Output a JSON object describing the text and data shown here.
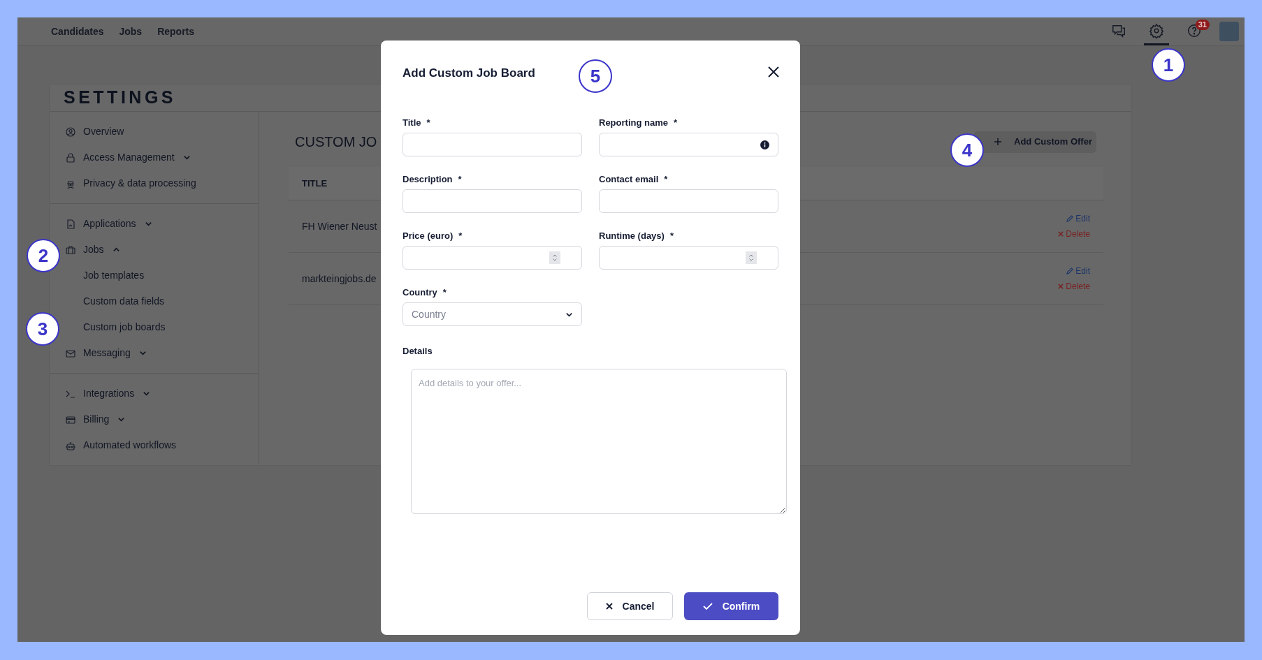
{
  "top_nav": {
    "links": [
      {
        "label": "Candidates"
      },
      {
        "label": "Jobs"
      },
      {
        "label": "Reports"
      }
    ],
    "icon_buttons": [
      {
        "kind": "chat",
        "selected": false
      },
      {
        "kind": "settings",
        "selected": true
      },
      {
        "kind": "help",
        "selected": false,
        "badge": "31"
      }
    ]
  },
  "settings": {
    "title": "SETTINGS",
    "sidebar": {
      "groups": [
        {
          "items": [
            {
              "label": "Overview"
            },
            {
              "label": "Access Management",
              "expanded": false
            },
            {
              "label": "Privacy & data processing"
            }
          ]
        },
        {
          "items": [
            {
              "label": "Applications",
              "expanded": false
            },
            {
              "label": "Jobs",
              "expanded": true,
              "children": [
                {
                  "label": "Job templates"
                },
                {
                  "label": "Custom data fields"
                },
                {
                  "label": "Custom job boards"
                }
              ]
            },
            {
              "label": "Messaging",
              "expanded": false
            }
          ]
        },
        {
          "items": [
            {
              "label": "Integrations",
              "expanded": false
            },
            {
              "label": "Billing",
              "expanded": false
            },
            {
              "label": "Automated workflows"
            }
          ]
        }
      ]
    },
    "main": {
      "title": "CUSTOM JO",
      "add_button": "Add Custom Offer",
      "table": {
        "columns": [
          "TITLE"
        ],
        "rows": [
          {
            "title": "FH Wiener Neust",
            "actions": [
              "Edit",
              "Delete"
            ]
          },
          {
            "title": "markteingjobs.de",
            "actions": [
              "Edit",
              "Delete"
            ]
          }
        ]
      }
    }
  },
  "modal": {
    "title": "Add Custom Job Board",
    "fields": [
      {
        "label": "Title",
        "required_mark": "*",
        "kind": "text"
      },
      {
        "label": "Reporting name",
        "required_mark": "*",
        "kind": "info"
      },
      {
        "label": "Description",
        "required_mark": "*",
        "kind": "text"
      },
      {
        "label": "Contact email",
        "required_mark": "*",
        "kind": "text"
      },
      {
        "label": "Price (euro)",
        "required_mark": "*",
        "kind": "number"
      },
      {
        "label": "Runtime (days)",
        "required_mark": "*",
        "kind": "number"
      },
      {
        "label": "Country",
        "required_mark": "*",
        "kind": "select",
        "placeholder": "Country"
      }
    ],
    "details": {
      "label": "Details",
      "placeholder": "Add details to your offer..."
    },
    "buttons": [
      {
        "label": "Cancel",
        "kind": "secondary"
      },
      {
        "label": "Confirm",
        "kind": "primary"
      }
    ]
  },
  "callouts": [
    "1",
    "2",
    "3",
    "4",
    "5"
  ]
}
